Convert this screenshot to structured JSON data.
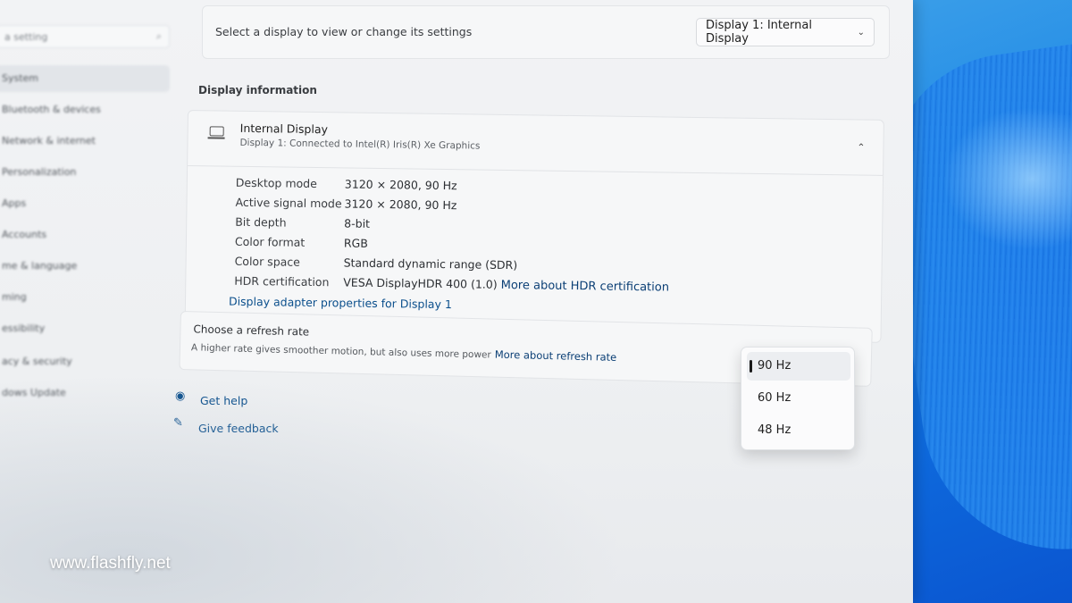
{
  "sidebar": {
    "search_placeholder": "a setting",
    "items": [
      {
        "label": "System",
        "selected": true
      },
      {
        "label": "Bluetooth & devices"
      },
      {
        "label": "Network & internet"
      },
      {
        "label": "Personalization"
      },
      {
        "label": "Apps"
      },
      {
        "label": "Accounts"
      },
      {
        "label": "me & language"
      },
      {
        "label": "ming"
      },
      {
        "label": "essibility"
      },
      {
        "label": "acy & security"
      },
      {
        "label": "dows Update"
      }
    ]
  },
  "display_select": {
    "label": "Select a display to view or change its settings",
    "selected": "Display 1: Internal Display"
  },
  "display_info": {
    "section_title": "Display information",
    "name": "Internal Display",
    "subtitle": "Display 1: Connected to Intel(R) Iris(R) Xe Graphics",
    "rows": [
      {
        "key": "Desktop mode",
        "value": "3120 × 2080, 90 Hz"
      },
      {
        "key": "Active signal mode",
        "value": "3120 × 2080, 90 Hz"
      },
      {
        "key": "Bit depth",
        "value": "8-bit"
      },
      {
        "key": "Color format",
        "value": "RGB"
      },
      {
        "key": "Color space",
        "value": "Standard dynamic range (SDR)"
      },
      {
        "key": "HDR certification",
        "value": "VESA DisplayHDR 400 (1.0)",
        "link": "More about HDR certification"
      }
    ],
    "adapter_link": "Display adapter properties for Display 1"
  },
  "refresh_rate": {
    "title": "Choose a refresh rate",
    "description": "A higher rate gives smoother motion, but also uses more power",
    "link": "More about refresh rate",
    "options": [
      "90 Hz",
      "60 Hz",
      "48 Hz"
    ],
    "selected_index": 0
  },
  "help": {
    "get_help": "Get help",
    "give_feedback": "Give feedback"
  },
  "watermark": "www.flashfly.net",
  "colors": {
    "link": "#0b4f8c",
    "wallpaper_blue": "#1673e0"
  }
}
